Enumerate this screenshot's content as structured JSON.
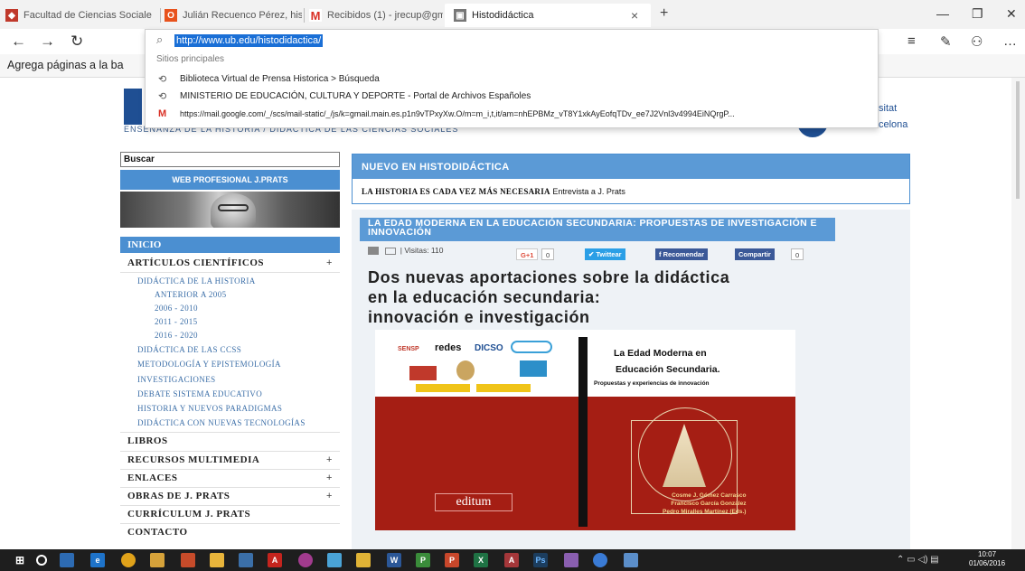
{
  "browser": {
    "tabs": [
      {
        "label": "Facultad de Ciencias Sociale",
        "icon": "site-icon",
        "color": "#c0392b"
      },
      {
        "label": "Julián Recuenco Pérez, histc",
        "icon": "office-icon",
        "color": "#e8521c"
      },
      {
        "label": "Recibidos (1) - jrecup@gma",
        "icon": "gmail-icon",
        "color": "#d93025"
      },
      {
        "label": "Histodidáctica",
        "icon": "page-icon",
        "color": "#555555"
      }
    ],
    "new_tab": "+",
    "close_tab": "×",
    "window": {
      "minimize": "—",
      "restore": "❐",
      "close": "✕"
    },
    "nav": {
      "back": "←",
      "forward": "→",
      "refresh": "↻"
    },
    "tools": {
      "hub": "≡",
      "note": "✎",
      "share": "⚇",
      "more": "…"
    },
    "favorites_text": "Agrega páginas a la ba",
    "address": {
      "url": "http://www.ub.edu/histodidactica/",
      "header": "Sitios principales",
      "suggestions": [
        {
          "icon": "history-icon",
          "text": "Biblioteca Virtual de Prensa Historica > Búsqueda"
        },
        {
          "icon": "history-icon",
          "text": "MINISTERIO DE EDUCACIÓN, CULTURA Y DEPORTE - Portal de Archivos Españoles"
        },
        {
          "icon": "gmail-icon",
          "text": "https://mail.google.com/_/scs/mail-static/_/js/k=gmail.main.es.p1n9vTPxyXw.O/m=m_i,t,it/am=nhEPBMz_vT8Y1xkAyEofqTDv_ee7J2Vnl3v4994EiNQrgP..."
        }
      ]
    }
  },
  "page": {
    "header_subtitle": "ENSEÑANZA DE LA HISTORIA / DIDÁCTICA DE LAS CIENCIAS SOCIALES",
    "ub_logo_line1": "sitat",
    "ub_logo_line2": "celona",
    "sidebar": {
      "search_label": "Buscar",
      "web_prof": "WEB PROFESIONAL J.PRATS",
      "inicio": "INICIO",
      "articulos": "ARTÍCULOS CIENTÍFICOS",
      "sub_items": [
        "DIDÁCTICA DE LA HISTORIA",
        "ANTERIOR A 2005",
        "2006 - 2010",
        "2011 - 2015",
        "2016 - 2020",
        "DIDÁCTICA DE LAS CCSS",
        "METODOLOGÍA Y EPISTEMOLOGÍA",
        "INVESTIGACIONES",
        "DEBATE SISTEMA EDUCATIVO",
        "HISTORIA Y NUEVOS PARADIGMAS",
        "DIDÁCTICA CON NUEVAS TECNOLOGÍAS"
      ],
      "libros": "LIBROS",
      "recursos": "RECURSOS MULTIMEDIA",
      "enlaces": "ENLACES",
      "obras": "OBRAS DE J. PRATS",
      "curriculum": "CURRÍCULUM J. PRATS",
      "contacto": "CONTACTO",
      "plus": "+"
    },
    "news": {
      "header": "NUEVO EN HISTODIDÁCTICA",
      "line_bold": "LA HISTORIA ES CADA VEZ MÁS NECESARIA",
      "line_rest": " Entrevista a J. Prats"
    },
    "article": {
      "title_bar": "LA EDAD MODERNA EN LA EDUCACIÓN SECUNDARIA: PROPUESTAS DE INVESTIGACIÓN E INNOVACIÓN",
      "visits": "| Visitas: 110",
      "gplus": "G+1",
      "gplus_count": "0",
      "twitter": "Twittear",
      "recomendar": "Recomendar",
      "compartir": "Compartir",
      "fb_count": "0",
      "headline_1": "Dos nuevas aportaciones sobre la didáctica",
      "headline_2": "en la educación secundaria:",
      "headline_3": "innovación e investigación"
    },
    "cover": {
      "title1": "La Edad Moderna en",
      "title2": "Educación Secundaria.",
      "subtitle": "Propuestas y experiencias de innovación",
      "editum": "editum",
      "author1": "Cosme J. Gómez Carrasco",
      "author2": "Francisco García González",
      "author3": "Pedro Miralles Martínez (Eds.)",
      "logo_sensp": "SENSP",
      "logo_redes": "redes",
      "logo_dicso": "DICSO"
    }
  },
  "taskbar": {
    "time": "10:07",
    "date": "01/06/2016"
  }
}
